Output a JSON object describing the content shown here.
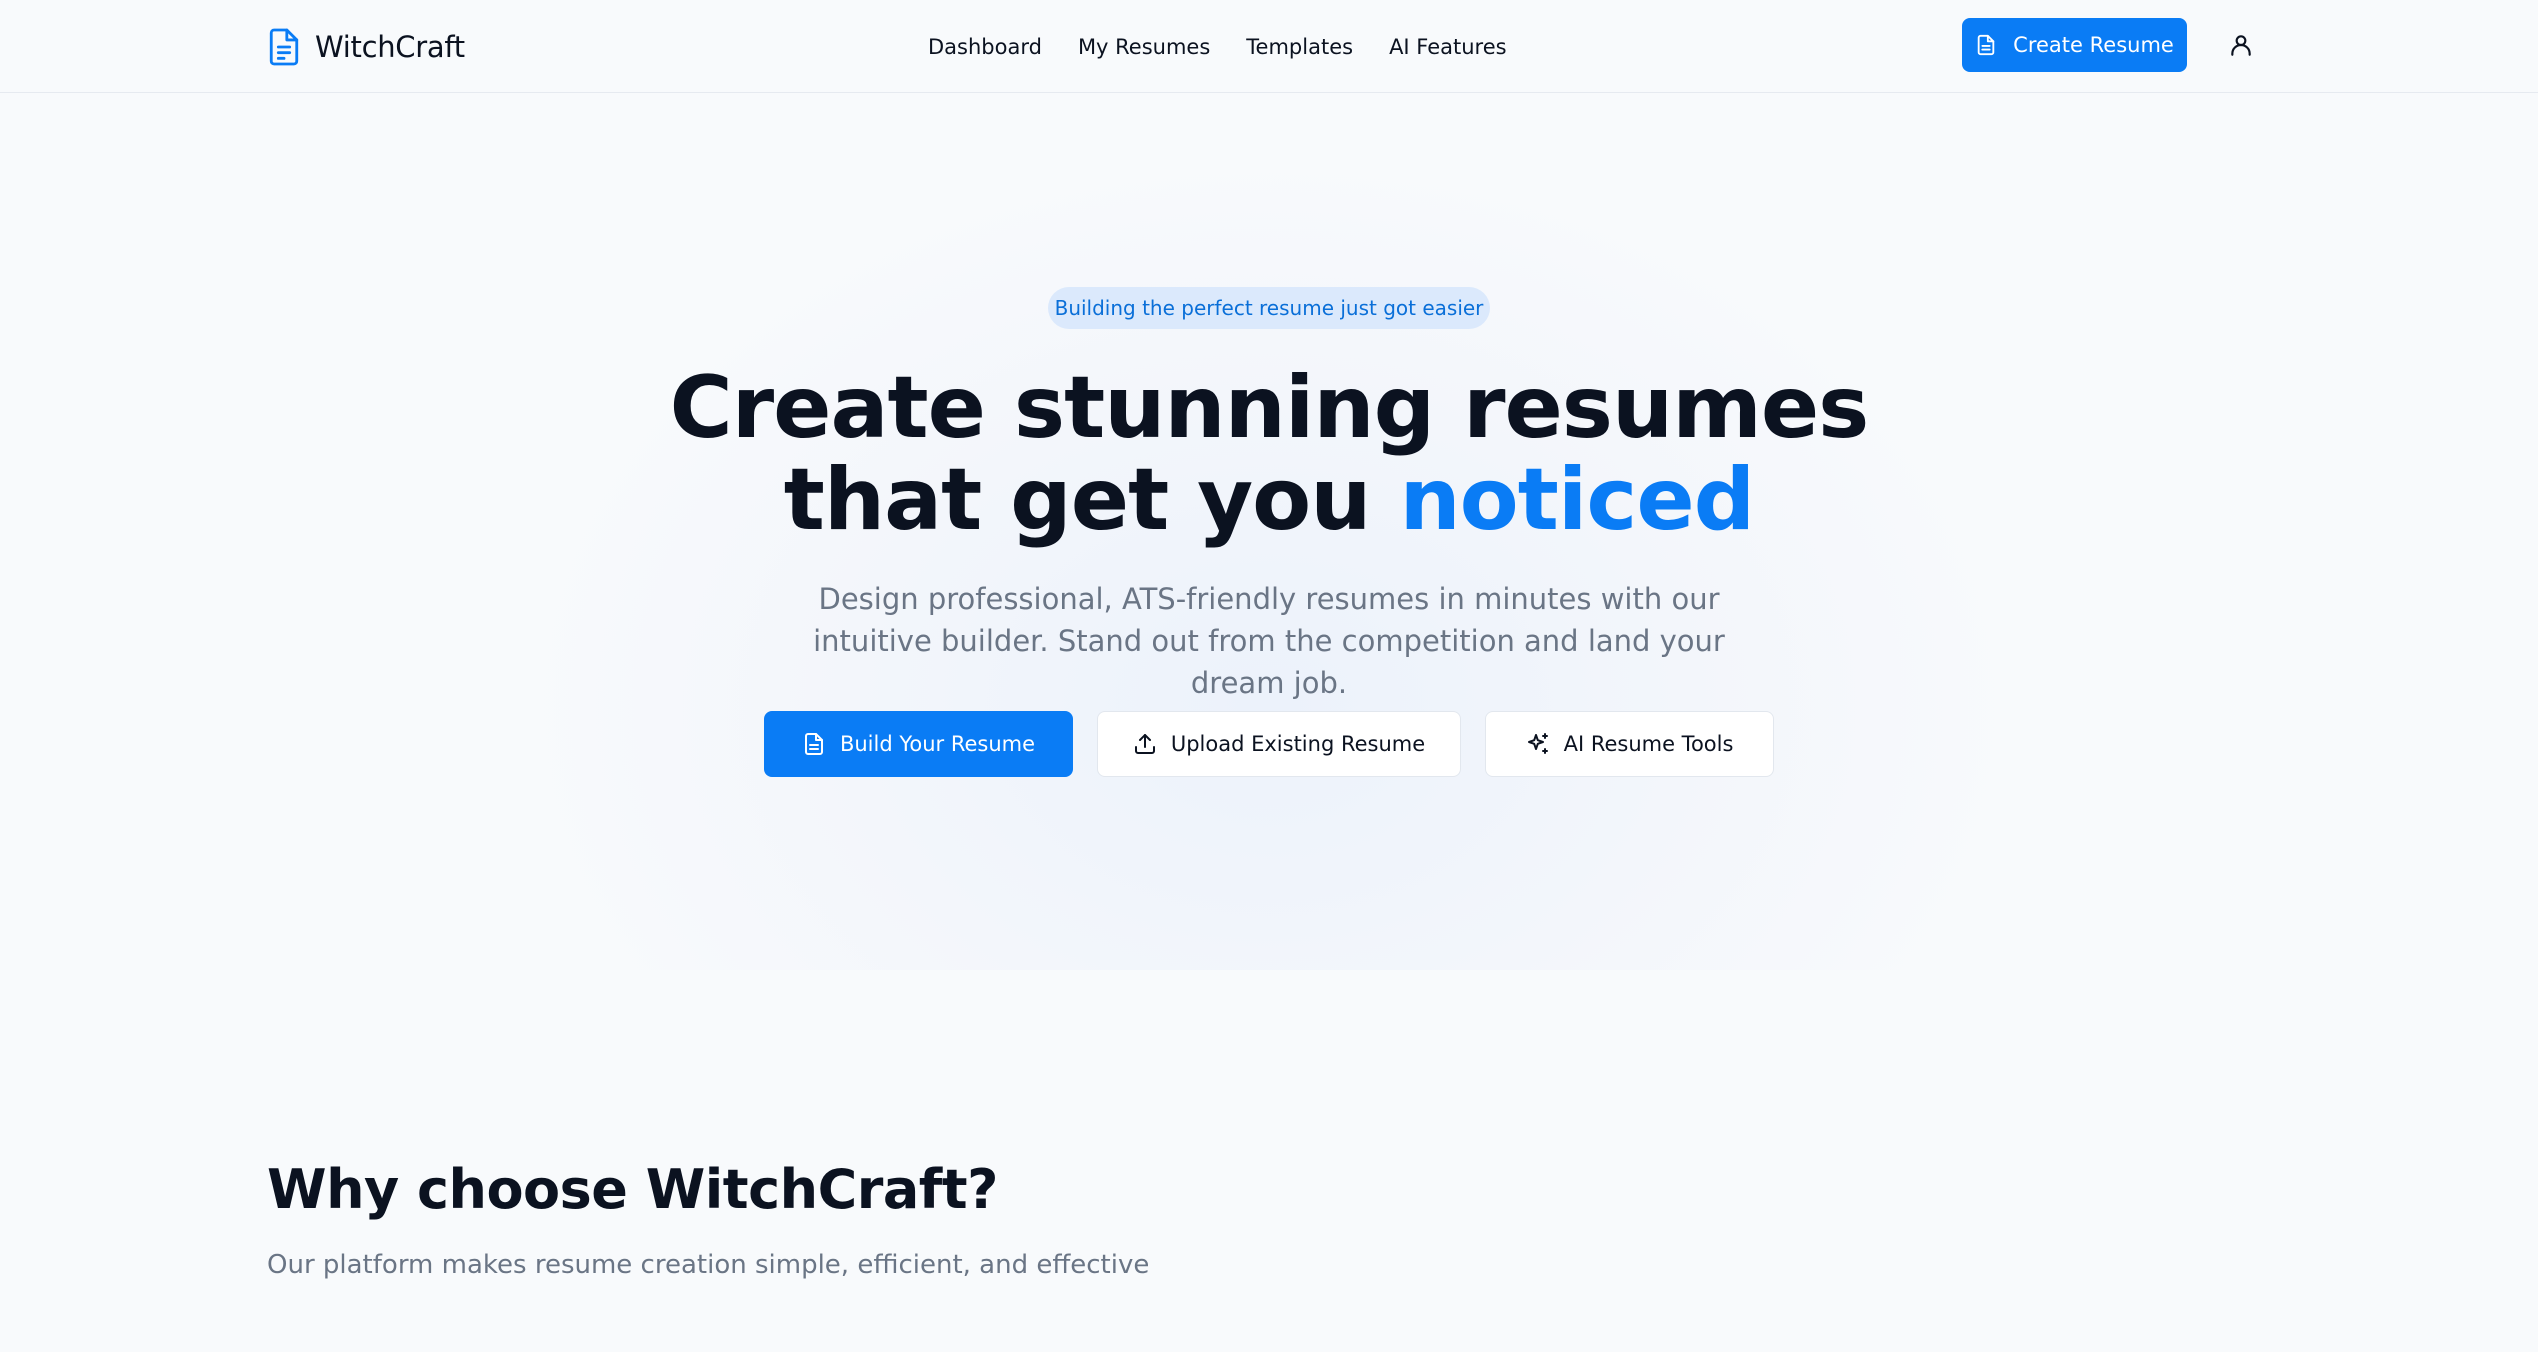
{
  "brand": {
    "name": "WitchCraft",
    "icon": "document-icon",
    "color": "#0a7cf5"
  },
  "nav": {
    "links": [
      "Dashboard",
      "My Resumes",
      "Templates",
      "AI Features"
    ],
    "create_button": "Create Resume",
    "user_icon": "user-icon"
  },
  "hero": {
    "badge": "Building the perfect resume just got easier",
    "headline_line1": "Create stunning resumes",
    "headline_line2_prefix": "that get you",
    "headline_line2_accent": "noticed",
    "subtext": "Design professional, ATS-friendly resumes in minutes with our intuitive builder. Stand out from the competition and land your dream job.",
    "buttons": {
      "build": "Build Your Resume",
      "upload": "Upload Existing Resume",
      "ai_tools": "AI Resume Tools"
    }
  },
  "features": {
    "title": "Why choose WitchCraft?",
    "subtitle": "Our platform makes resume creation simple, efficient, and effective"
  },
  "colors": {
    "accent": "#0a7cf5",
    "badge_bg": "#dbe9fc",
    "text_muted": "#6a7585"
  }
}
